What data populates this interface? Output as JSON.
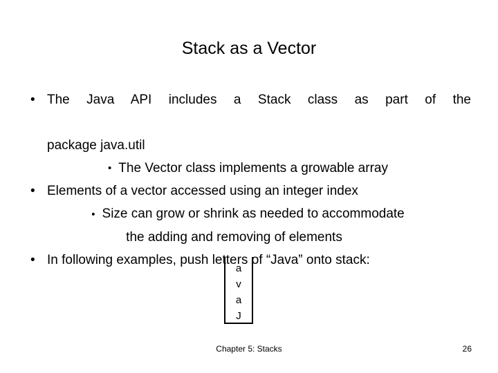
{
  "slide": {
    "title": "Stack as a Vector",
    "background_color": "#ffffff",
    "text_color": "#000000",
    "bullet_glyph": "•"
  },
  "bullets": [
    {
      "level": 1,
      "text_line_1": "The Java API includes a Stack class as part of the",
      "text_line_2": "package java.util"
    },
    {
      "level": 2,
      "text_line_1": "The Vector class implements a growable array"
    },
    {
      "level": 1,
      "text_line_1": "Elements of a vector accessed using an integer index"
    },
    {
      "level": 2,
      "text_line_1": "Size can grow or shrink as needed to accommodate",
      "text_line_2": "the adding and removing of elements"
    },
    {
      "level": 1,
      "text_line_1": "In following examples, push letters of “Java” onto stack:"
    }
  ],
  "stack_figure": {
    "caption": "",
    "cells_top_to_bottom": [
      "a",
      "v",
      "a",
      "J"
    ],
    "border_color": "#000000",
    "open_top": true
  },
  "footer": {
    "center_text": "Chapter 5: Stacks",
    "page_number": "26"
  }
}
